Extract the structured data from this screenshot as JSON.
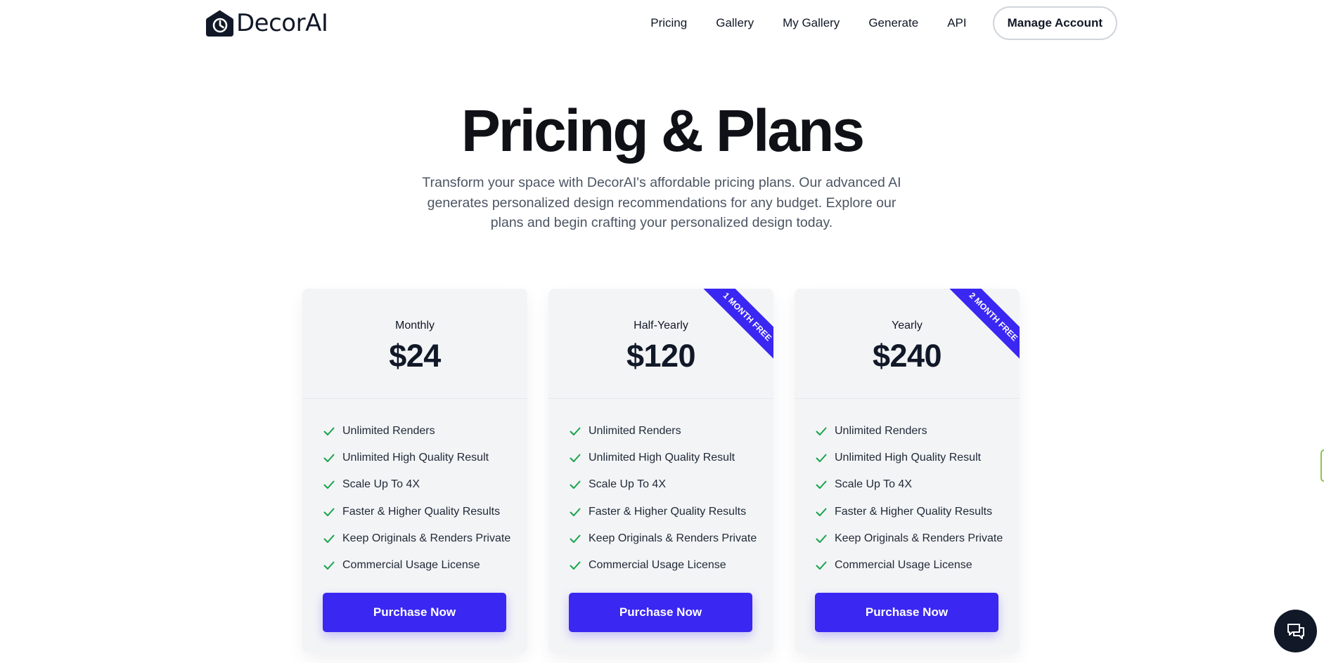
{
  "brand": {
    "name": "DecorAI"
  },
  "nav": {
    "links": [
      "Pricing",
      "Gallery",
      "My Gallery",
      "Generate",
      "API"
    ],
    "manage_account": "Manage Account"
  },
  "hero": {
    "title": "Pricing & Plans",
    "subtitle": "Transform your space with DecorAI's affordable pricing plans. Our advanced AI generates personalized design recommendations for any budget. Explore our plans and begin crafting your personalized design today."
  },
  "plans": [
    {
      "name": "Monthly",
      "price": "$24",
      "ribbon": null,
      "features": [
        "Unlimited Renders",
        "Unlimited High Quality Result",
        "Scale Up To 4X",
        "Faster & Higher Quality Results",
        "Keep Originals & Renders Private",
        "Commercial Usage License"
      ],
      "cta": "Purchase Now"
    },
    {
      "name": "Half-Yearly",
      "price": "$120",
      "ribbon": "1 MONTH FREE",
      "features": [
        "Unlimited Renders",
        "Unlimited High Quality Result",
        "Scale Up To 4X",
        "Faster & Higher Quality Results",
        "Keep Originals & Renders Private",
        "Commercial Usage License"
      ],
      "cta": "Purchase Now"
    },
    {
      "name": "Yearly",
      "price": "$240",
      "ribbon": "2 MONTH FREE",
      "features": [
        "Unlimited Renders",
        "Unlimited High Quality Result",
        "Scale Up To 4X",
        "Faster & Higher Quality Results",
        "Keep Originals & Renders Private",
        "Commercial Usage License"
      ],
      "cta": "Purchase Now"
    }
  ],
  "colors": {
    "accent": "#3a27f2",
    "check": "#16a34a",
    "card_bg": "#f3f4f6",
    "text": "#111827"
  },
  "icons": {
    "logo": "house-clock-icon",
    "check": "check-icon",
    "chat": "chat-bubbles-icon"
  }
}
